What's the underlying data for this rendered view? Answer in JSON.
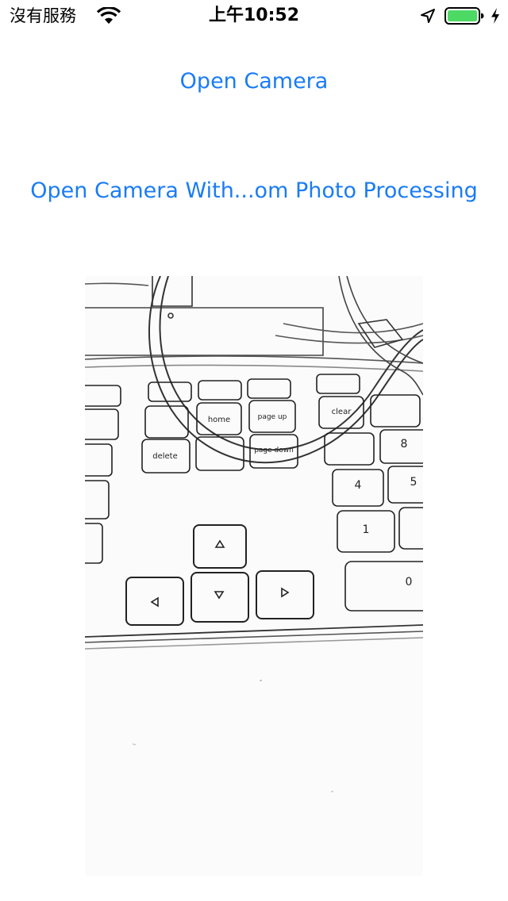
{
  "status_bar": {
    "carrier": "沒有服務",
    "time": "上午10:52",
    "battery_color": "#4cd964",
    "icons": [
      "wifi-icon",
      "location-arrow-icon",
      "battery-icon",
      "charging-bolt-icon"
    ]
  },
  "buttons": {
    "open_camera": "Open Camera",
    "open_camera_custom": "Open Camera With...om Photo Processing"
  },
  "photo": {
    "description_icon": "sketch-filtered-keyboard-photo",
    "key_labels": {
      "home": "home",
      "page_up": "page up",
      "page_down": "page down",
      "delete": "delete",
      "clear": "clear",
      "num_4": "4",
      "num_5": "5",
      "num_8": "8",
      "num_1": "1",
      "num_0": "0"
    }
  },
  "colors": {
    "link": "#1a7cf5",
    "background": "#ffffff"
  }
}
